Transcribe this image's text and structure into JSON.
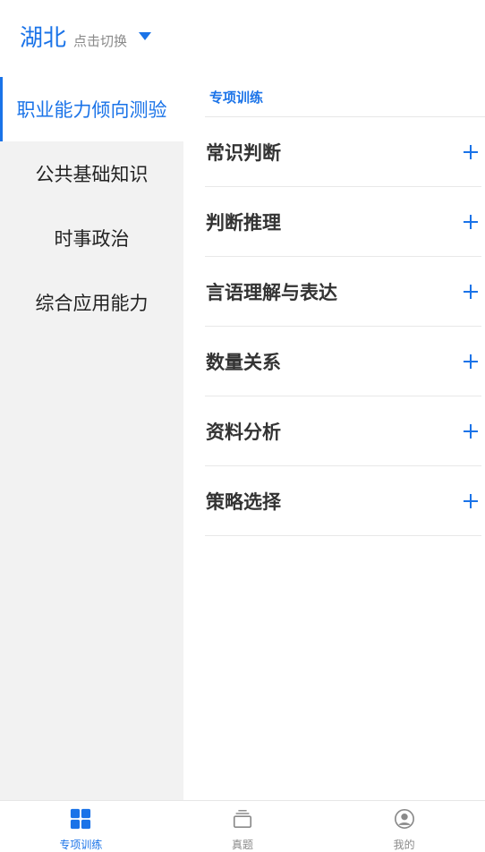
{
  "header": {
    "region": "湖北",
    "switch_hint": "点击切换",
    "caret_icon": "caret-down-icon"
  },
  "sidebar": {
    "items": [
      {
        "label": "职业能力倾向测验",
        "active": true
      },
      {
        "label": "公共基础知识",
        "active": false
      },
      {
        "label": "时事政治",
        "active": false
      },
      {
        "label": "综合应用能力",
        "active": false
      }
    ]
  },
  "content": {
    "section_title": "专项训练",
    "topics": [
      {
        "label": "常识判断"
      },
      {
        "label": "判断推理"
      },
      {
        "label": "言语理解与表达"
      },
      {
        "label": "数量关系"
      },
      {
        "label": "资料分析"
      },
      {
        "label": "策略选择"
      }
    ],
    "expand_icon": "plus-icon"
  },
  "tabbar": {
    "tabs": [
      {
        "label": "专项训练",
        "icon": "grid-icon",
        "active": true
      },
      {
        "label": "真题",
        "icon": "stack-icon",
        "active": false
      },
      {
        "label": "我的",
        "icon": "user-circle-icon",
        "active": false
      }
    ]
  },
  "colors": {
    "accent": "#1a73e8",
    "sidebar_bg": "#f2f2f2",
    "text": "#333333",
    "muted": "#8a8a8a"
  }
}
